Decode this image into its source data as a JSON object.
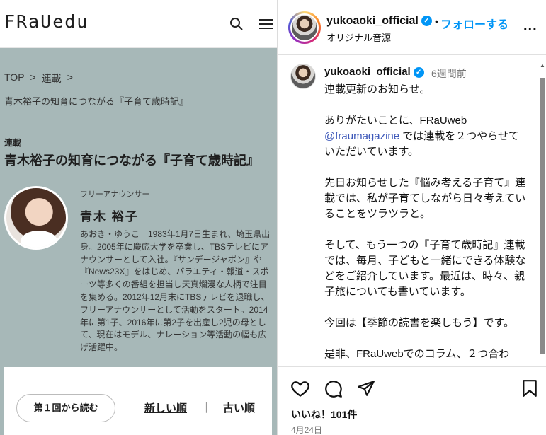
{
  "left_panel": {
    "logo": "FRaUedu",
    "icons": {
      "search": "search-icon",
      "menu": "hamburger-menu-icon"
    },
    "breadcrumb": {
      "items": [
        "TOP",
        ">",
        "連載",
        ">"
      ],
      "current": "青木裕子の知育につながる『子育て歳時記』"
    },
    "series_label": "連載",
    "series_title": "青木裕子の知育につながる『子育て歳時記』",
    "author": {
      "role": "フリーアナウンサー",
      "name": "青木 裕子",
      "bio": "あおき・ゆうこ　1983年1月7日生まれ、埼玉県出身。2005年に慶応大学を卒業し、TBSテレビにアナウンサーとして入社。『サンデージャポン』や『News23X』をはじめ、バラエティ・報道・スポーツ等多くの番組を担当し天真爛漫な人柄で注目を集める。2012年12月末にTBSテレビを退職し、フリーアナウンサーとして活動をスタート。2014年に第1子、2016年に第2子を出産し2児の母として、現在はモデル、ナレーション等活動の幅も広げ活躍中。"
    },
    "buttons": {
      "read_first": "第１回から読む",
      "sort_new": "新しい順",
      "sort_separator": "|",
      "sort_old": "古い順"
    },
    "colors": {
      "panel_bg": "#a7b8b8"
    }
  },
  "instagram": {
    "header": {
      "username": "yukoaoki_official",
      "verified_icon": "verified-badge-icon",
      "separator": "•",
      "follow": "フォローする",
      "audio": "オリジナル音源",
      "more": "..."
    },
    "post": {
      "username": "yukoaoki_official",
      "time": "6週間前",
      "text_1": "連載更新のお知らせ。\n\nありがたいことに、FRaUweb\n",
      "mention": "@fraumagazine",
      "text_2": " では連載を２つやらせていただいています。\n\n先日お知らせした『悩み考える子育て』連載では、私が子育てしながら日々考えていることをツラツラと。\n\nそして、もう一つの『子育て歳時記』連載では、毎月、子どもと一緒にできる体験などをご紹介しています。最近は、時々、親子旅についても書いています。\n\n今回は【季節の読書を楽しもう】です。\n\n是非、FRaUwebでのコラム、２つ合わ"
    },
    "actions": {
      "heart": "heart-icon",
      "comment": "comment-icon",
      "share": "share-icon",
      "save": "bookmark-icon"
    },
    "likes": "いいね！101件",
    "date": "4月24日",
    "colors": {
      "link": "#0095f6",
      "mention": "#3d58b9"
    }
  }
}
